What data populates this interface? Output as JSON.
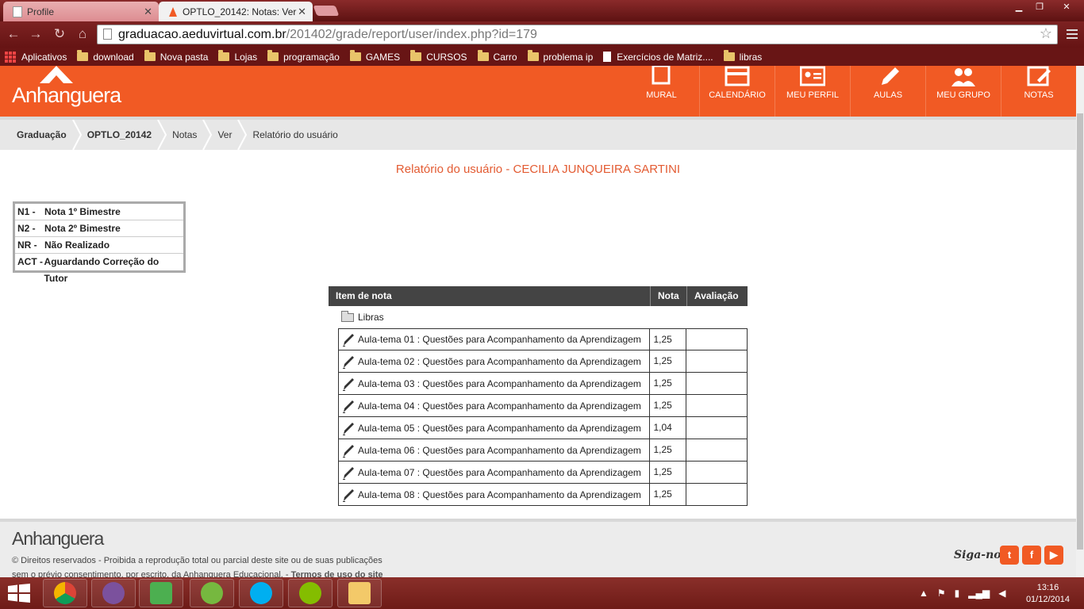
{
  "browser": {
    "tabs": [
      {
        "title": "Profile",
        "active": false
      },
      {
        "title": "OPTLO_20142: Notas: Ver",
        "active": true
      }
    ],
    "url_host": "graduacao.aeduvirtual.com.br",
    "url_path": "/201402/grade/report/user/index.php?id=179",
    "bookmarks": [
      "Aplicativos",
      "download",
      "Nova pasta",
      "Lojas",
      "programação",
      "GAMES",
      "CURSOS",
      "Carro",
      "problema ip",
      "Exercícios de Matriz....",
      "libras"
    ]
  },
  "site": {
    "logo": "Anhanguera",
    "brand_color": "#f15a24",
    "nav": [
      {
        "label": "MURAL",
        "icon": "mural-icon"
      },
      {
        "label": "CALENDÁRIO",
        "icon": "calendar-icon"
      },
      {
        "label": "MEU PERFIL",
        "icon": "profile-card-icon"
      },
      {
        "label": "AULAS",
        "icon": "pencil-icon"
      },
      {
        "label": "MEU GRUPO",
        "icon": "group-icon"
      },
      {
        "label": "NOTAS",
        "icon": "notes-icon"
      }
    ]
  },
  "breadcrumb": [
    "Graduação",
    "OPTLO_20142",
    "Notas",
    "Ver",
    "Relatório do usuário"
  ],
  "report_title": "Relatório do usuário - CECILIA JUNQUEIRA SARTINI",
  "legend": [
    {
      "code": "N1 -",
      "text": "Nota 1º Bimestre"
    },
    {
      "code": "N2 -",
      "text": "Nota 2º Bimestre"
    },
    {
      "code": "NR -",
      "text": "Não Realizado"
    },
    {
      "code": "ACT -",
      "text": "Aguardando Correção do Tutor"
    }
  ],
  "grades": {
    "headers": {
      "item": "Item de nota",
      "nota": "Nota",
      "avaliacao": "Avaliação"
    },
    "category": "Libras",
    "rows": [
      {
        "item": "Aula-tema 01 : Questões para Acompanhamento da Aprendizagem",
        "nota": "1,25",
        "avaliacao": ""
      },
      {
        "item": "Aula-tema 02 : Questões para Acompanhamento da Aprendizagem",
        "nota": "1,25",
        "avaliacao": ""
      },
      {
        "item": "Aula-tema 03 : Questões para Acompanhamento da Aprendizagem",
        "nota": "1,25",
        "avaliacao": ""
      },
      {
        "item": "Aula-tema 04 : Questões para Acompanhamento da Aprendizagem",
        "nota": "1,25",
        "avaliacao": ""
      },
      {
        "item": "Aula-tema 05 : Questões para Acompanhamento da Aprendizagem",
        "nota": "1,04",
        "avaliacao": ""
      },
      {
        "item": "Aula-tema 06 : Questões para Acompanhamento da Aprendizagem",
        "nota": "1,25",
        "avaliacao": ""
      },
      {
        "item": "Aula-tema 07 : Questões para Acompanhamento da Aprendizagem",
        "nota": "1,25",
        "avaliacao": ""
      },
      {
        "item": "Aula-tema 08 : Questões para Acompanhamento da Aprendizagem",
        "nota": "1,25",
        "avaliacao": ""
      }
    ]
  },
  "footer": {
    "logo": "Anhanguera",
    "line1": "© Direitos reservados - Proibida a reprodução total ou parcial deste site ou de suas publicações",
    "line2": "sem o prévio consentimento, por escrito, da Anhanguera Educacional. -",
    "terms_link": "Termos de uso do site",
    "follow": "Siga-nos:",
    "social": [
      "twitter-icon",
      "facebook-icon",
      "youtube-icon"
    ]
  },
  "taskbar": {
    "time": "13:16",
    "date": "01/12/2014",
    "apps": [
      "chrome-icon",
      "viber-icon",
      "messenger-icon",
      "utorrent-icon",
      "skype-icon",
      "spotify-icon",
      "file-explorer-icon"
    ]
  }
}
